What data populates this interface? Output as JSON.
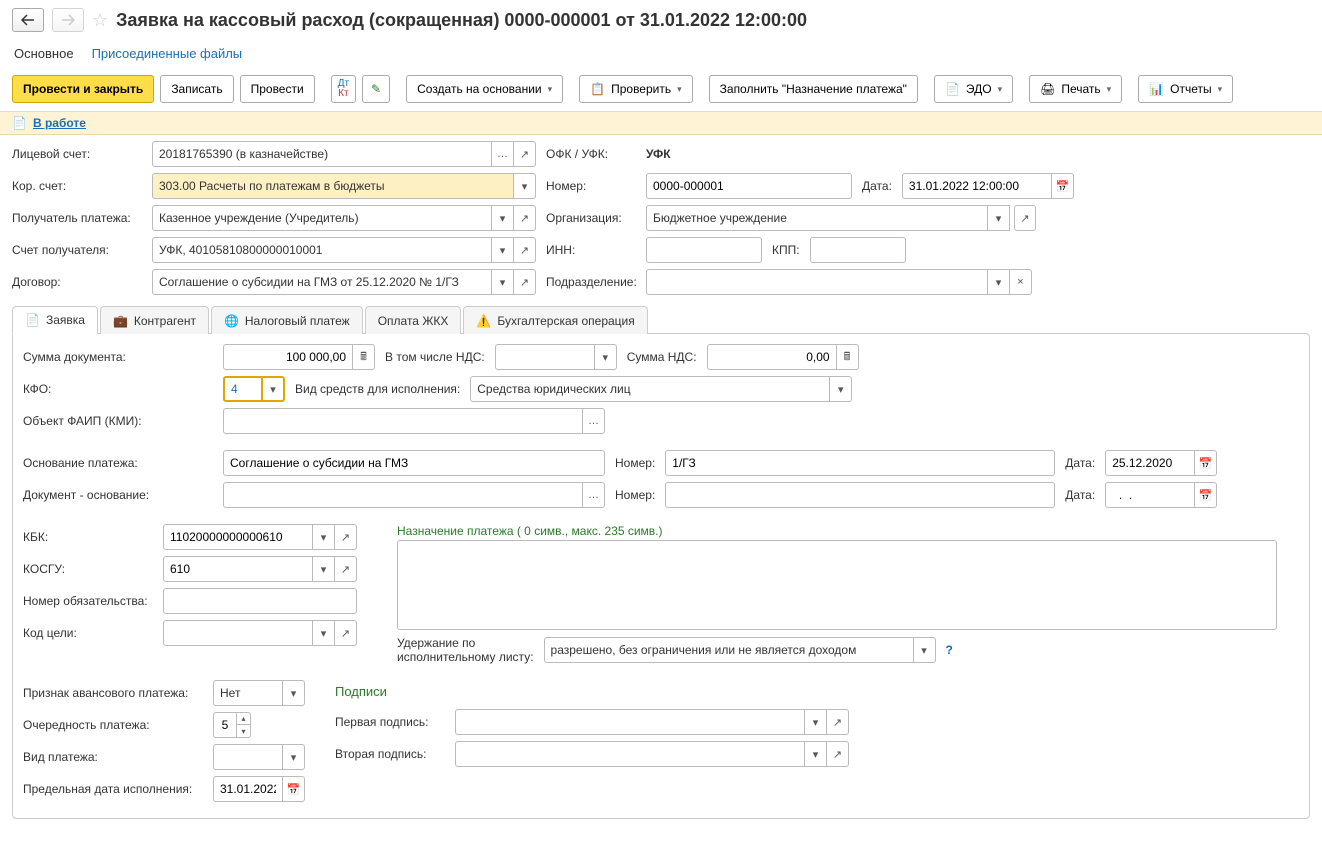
{
  "header": {
    "title": "Заявка на кассовый расход (сокращенная) 0000-000001 от 31.01.2022 12:00:00"
  },
  "subnav": {
    "main": "Основное",
    "files": "Присоединенные файлы"
  },
  "toolbar": {
    "post_close": "Провести и закрыть",
    "save": "Записать",
    "post": "Провести",
    "create_based": "Создать на основании",
    "check": "Проверить",
    "fill_purpose": "Заполнить \"Назначение платежа\"",
    "edo": "ЭДО",
    "print": "Печать",
    "reports": "Отчеты"
  },
  "status": {
    "text": "В работе"
  },
  "form": {
    "account_label": "Лицевой счет:",
    "account_value": "20181765390 (в казначействе)",
    "ofk_label": "ОФК / УФК:",
    "ofk_value": "УФК",
    "korr_label": "Кор. счет:",
    "korr_value": "303.00 Расчеты по платежам в бюджеты",
    "number_label": "Номер:",
    "number_value": "0000-000001",
    "date_label": "Дата:",
    "date_value": "31.01.2022 12:00:00",
    "payee_label": "Получатель платежа:",
    "payee_value": "Казенное учреждение (Учредитель)",
    "org_label": "Организация:",
    "org_value": "Бюджетное учреждение",
    "payee_acc_label": "Счет получателя:",
    "payee_acc_value": "УФК, 40105810800000010001",
    "inn_label": "ИНН:",
    "kpp_label": "КПП:",
    "contract_label": "Договор:",
    "contract_value": "Соглашение о субсидии на ГМЗ от 25.12.2020 № 1/ГЗ",
    "dept_label": "Подразделение:"
  },
  "tabs": {
    "request": "Заявка",
    "counterparty": "Контрагент",
    "tax": "Налоговый платеж",
    "utility": "Оплата ЖКХ",
    "accounting": "Бухгалтерская операция"
  },
  "request": {
    "doc_sum_label": "Сумма документа:",
    "doc_sum_value": "100 000,00",
    "incl_vat_label": "В том числе НДС:",
    "vat_sum_label": "Сумма НДС:",
    "vat_sum_value": "0,00",
    "kfo_label": "КФО:",
    "kfo_value": "4",
    "funds_label": "Вид средств для исполнения:",
    "funds_value": "Средства юридических лиц",
    "faip_label": "Объект ФАИП (КМИ):",
    "basis_label": "Основание платежа:",
    "basis_value": "Соглашение о субсидии на ГМЗ",
    "basis_num_label": "Номер:",
    "basis_num_value": "1/ГЗ",
    "basis_date_label": "Дата:",
    "basis_date_value": "25.12.2020",
    "doc_basis_label": "Документ - основание:",
    "doc_basis_num_label": "Номер:",
    "doc_basis_date_label": "Дата:",
    "doc_basis_date_value": "  .  .    ",
    "kbk_label": "КБК:",
    "kbk_value": "11020000000000610",
    "purpose_hint": "Назначение платежа ( 0 симв., макс. 235 симв.)",
    "kosgu_label": "КОСГУ:",
    "kosgu_value": "610",
    "obligation_label": "Номер обязательства:",
    "goal_label": "Код цели:",
    "withhold_label1": "Удержание по",
    "withhold_label2": "исполнительному листу:",
    "withhold_value": "разрешено, без ограничения или не является доходом",
    "advance_label": "Признак авансового платежа:",
    "advance_value": "Нет",
    "priority_label": "Очередность платежа:",
    "priority_value": "5",
    "paytype_label": "Вид платежа:",
    "deadline_label": "Предельная дата исполнения:",
    "deadline_value": "31.01.2022",
    "signatures": "Подписи",
    "sig1_label": "Первая подпись:",
    "sig2_label": "Вторая подпись:"
  }
}
